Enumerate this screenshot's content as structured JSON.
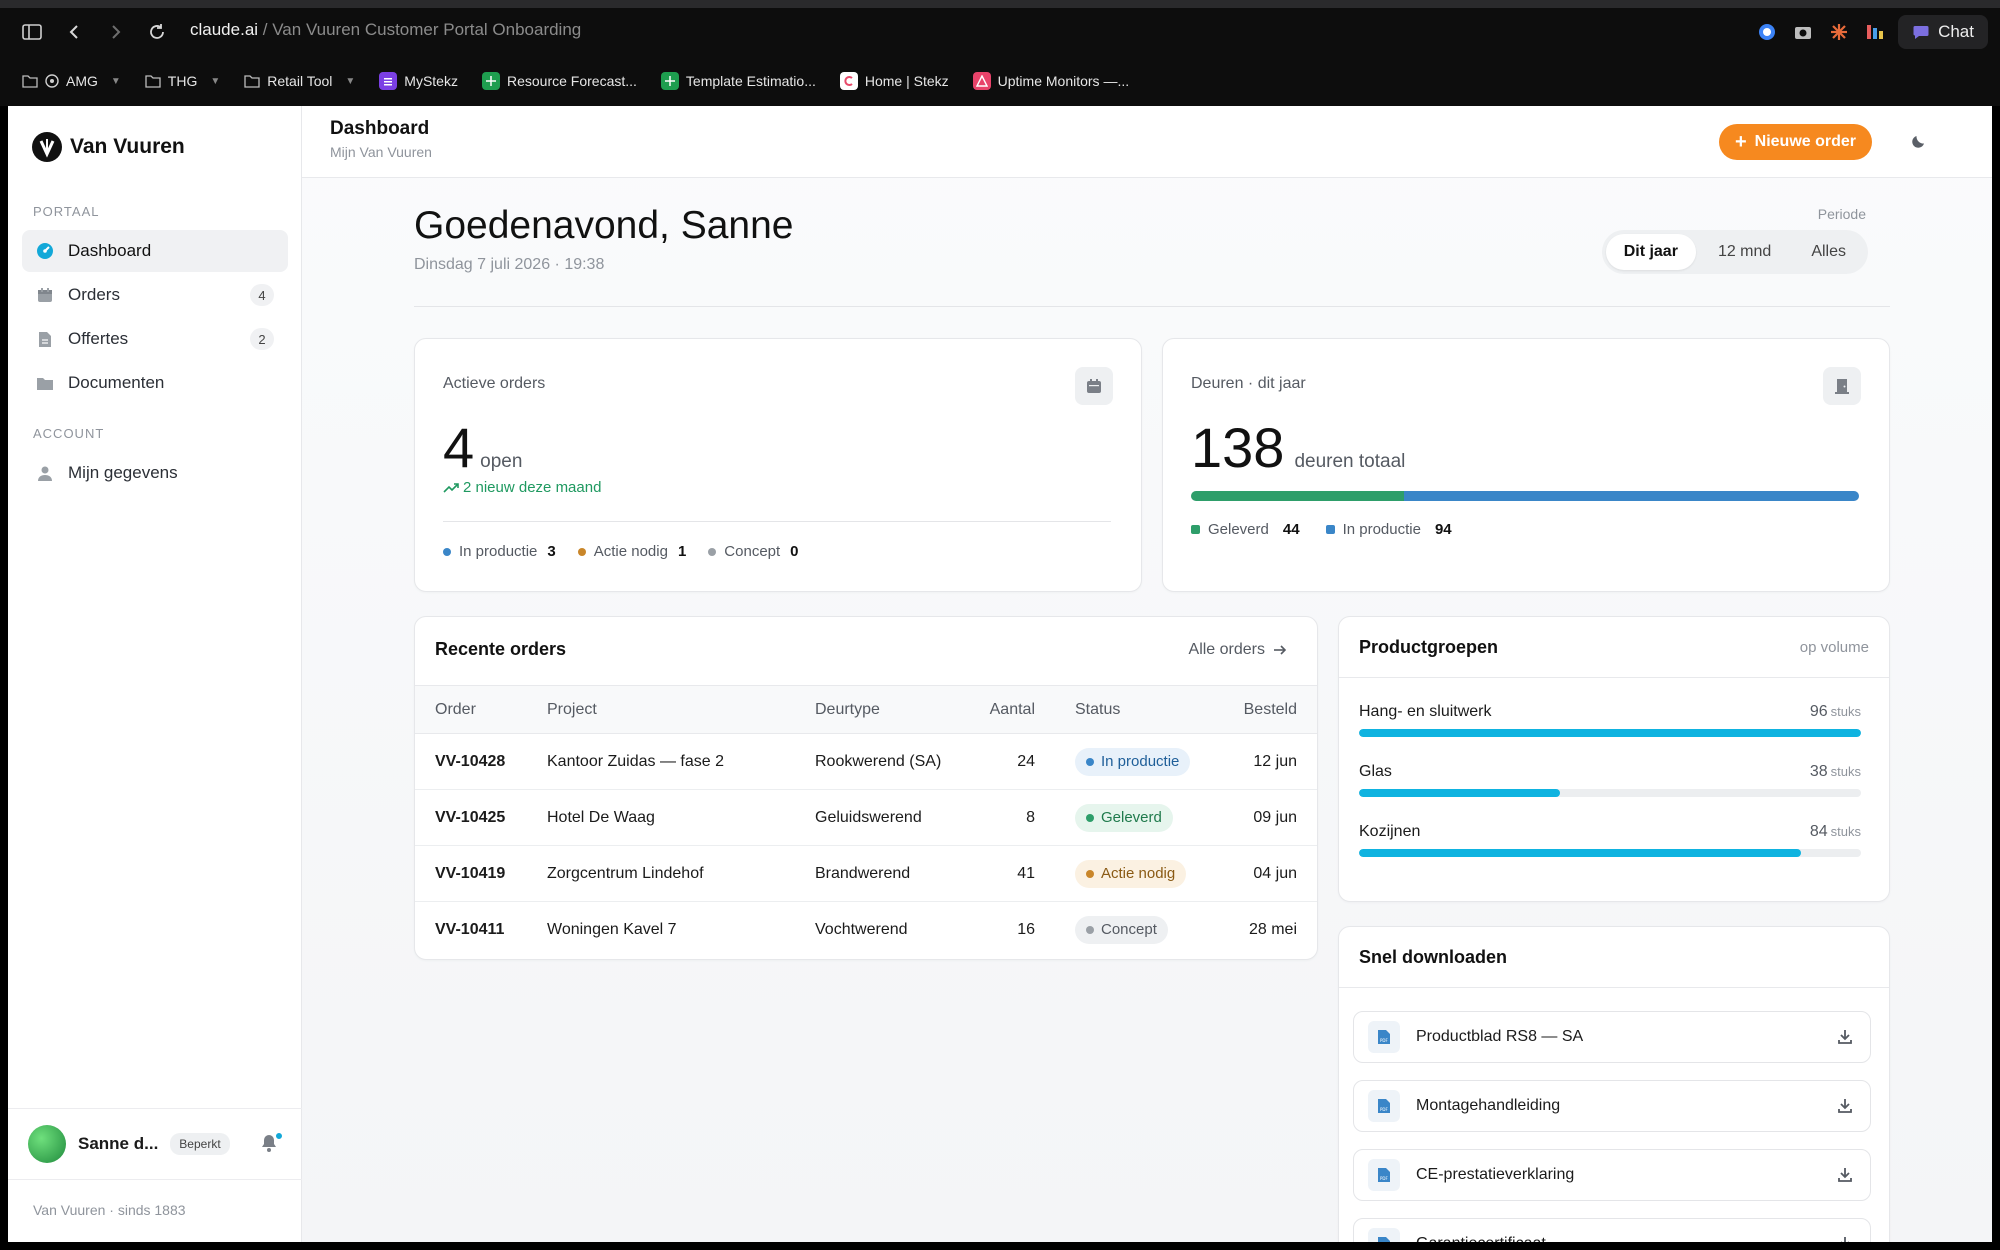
{
  "browser": {
    "domain": "claude.ai",
    "separator": " / ",
    "path": "Van Vuuren Customer Portal Onboarding",
    "chat_label": "Chat",
    "bookmarks": [
      {
        "label": "AMG",
        "folder": true
      },
      {
        "label": "THG",
        "folder": true
      },
      {
        "label": "Retail Tool",
        "folder": true
      },
      {
        "label": "MyStekz",
        "folder": false
      },
      {
        "label": "Resource Forecast...",
        "folder": false
      },
      {
        "label": "Template Estimatio...",
        "folder": false
      },
      {
        "label": "Home | Stekz",
        "folder": false
      },
      {
        "label": "Uptime Monitors —...",
        "folder": false
      }
    ]
  },
  "sidebar": {
    "brand": "Van Vuuren",
    "section_portal": "Portaal",
    "section_account": "Account",
    "items": [
      {
        "label": "Dashboard",
        "icon": "dashboard-icon",
        "count": ""
      },
      {
        "label": "Orders",
        "icon": "calendar-icon",
        "count": "4"
      },
      {
        "label": "Offertes",
        "icon": "document-icon",
        "count": "2"
      },
      {
        "label": "Documenten",
        "icon": "folder-icon",
        "count": ""
      },
      {
        "label": "Mijn gegevens",
        "icon": "user-icon",
        "count": ""
      }
    ],
    "user": {
      "name": "Sanne d...",
      "badge": "Beperkt"
    },
    "footer": "Van Vuuren · sinds 1883"
  },
  "topbar": {
    "title": "Dashboard",
    "subtitle": "Mijn Van Vuuren",
    "new_order": "Nieuwe order"
  },
  "header": {
    "greeting": "Goedenavond, Sanne",
    "date": "Dinsdag 7 juli 2026 · 19:38",
    "period_label": "Periode",
    "periods": [
      "Dit jaar",
      "12 mnd",
      "Alles"
    ],
    "active_period": 0
  },
  "active_orders": {
    "label": "Actieve orders",
    "value": "4",
    "unit": "open",
    "trend": "2 nieuw deze maand",
    "legend": [
      {
        "label": "In productie",
        "value": "3",
        "color": "#3a86c8"
      },
      {
        "label": "Actie nodig",
        "value": "1",
        "color": "#c9862a"
      },
      {
        "label": "Concept",
        "value": "0",
        "color": "#9aa0a6"
      }
    ]
  },
  "doors": {
    "label": "Deuren · dit jaar",
    "value": "138",
    "unit": "deuren totaal",
    "segments": [
      {
        "label": "Geleverd",
        "value": 44,
        "display": "44",
        "color": "#2e9e6a"
      },
      {
        "label": "In productie",
        "value": 94,
        "display": "94",
        "color": "#3a86c8"
      }
    ]
  },
  "recent_orders": {
    "title": "Recente orders",
    "link": "Alle orders",
    "columns": [
      "Order",
      "Project",
      "Deurtype",
      "Aantal",
      "Status",
      "Besteld"
    ],
    "rows": [
      {
        "order": "VV-10428",
        "project": "Kantoor Zuidas — fase 2",
        "type": "Rookwerend (SA)",
        "qty": "24",
        "status": "In productie",
        "status_kind": "production",
        "date": "12 jun"
      },
      {
        "order": "VV-10425",
        "project": "Hotel De Waag",
        "type": "Geluidswerend",
        "qty": "8",
        "status": "Geleverd",
        "status_kind": "delivered",
        "date": "09 jun"
      },
      {
        "order": "VV-10419",
        "project": "Zorgcentrum Lindehof",
        "type": "Brandwerend",
        "qty": "41",
        "status": "Actie nodig",
        "status_kind": "action",
        "date": "04 jun"
      },
      {
        "order": "VV-10411",
        "project": "Woningen Kavel 7",
        "type": "Vochtwerend",
        "qty": "16",
        "status": "Concept",
        "status_kind": "concept",
        "date": "28 mei"
      }
    ]
  },
  "status_colors": {
    "production": {
      "bg": "#e8f1fa",
      "fg": "#1f5f99",
      "dot": "#3a86c8"
    },
    "delivered": {
      "bg": "#e6f5ed",
      "fg": "#1f7a4c",
      "dot": "#2e9e6a"
    },
    "action": {
      "bg": "#fbf1e2",
      "fg": "#8a5a14",
      "dot": "#c9862a"
    },
    "concept": {
      "bg": "#eef0f2",
      "fg": "#555a62",
      "dot": "#9aa0a6"
    }
  },
  "product_groups": {
    "title": "Productgroepen",
    "subtitle": "op volume",
    "unit": "stuks",
    "items": [
      {
        "name": "Hang- en sluitwerk",
        "value": "96",
        "fraction": 1.0
      },
      {
        "name": "Glas",
        "value": "38",
        "fraction": 0.4
      },
      {
        "name": "Kozijnen",
        "value": "84",
        "fraction": 0.88
      }
    ]
  },
  "downloads": {
    "title": "Snel downloaden",
    "items": [
      {
        "name": "Productblad RS8 — SA"
      },
      {
        "name": "Montagehandleiding"
      },
      {
        "name": "CE-prestatieverklaring"
      },
      {
        "name": "Garantiecertificaat"
      }
    ]
  },
  "colors": {
    "accent": "#f6891f",
    "bar": "#0fb3e0"
  }
}
